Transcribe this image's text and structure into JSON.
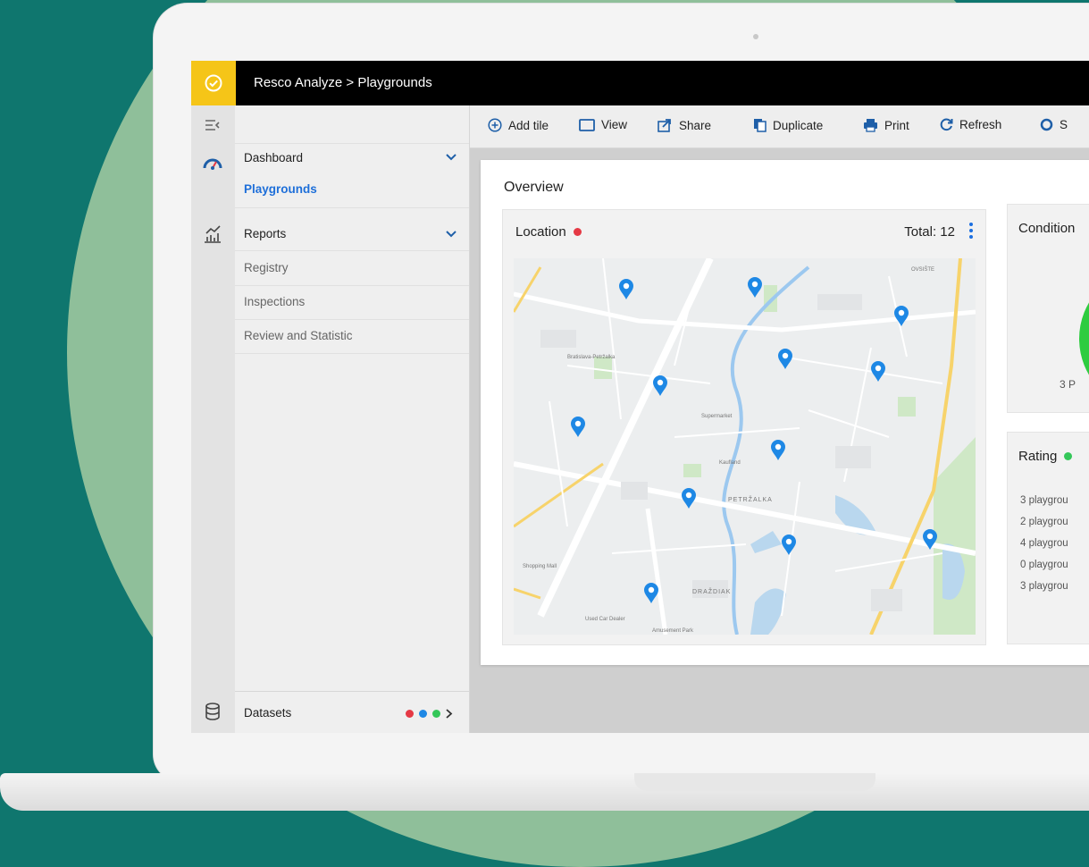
{
  "app": {
    "breadcrumb": "Resco Analyze  >  Playgrounds",
    "brand_color": "#f5c518"
  },
  "sidebar": {
    "sections": [
      {
        "label": "Dashboard",
        "items": [
          "Playgrounds"
        ],
        "active_item": "Playgrounds"
      },
      {
        "label": "Reports",
        "items": [
          "Registry",
          "Inspections",
          "Review and Statistic"
        ]
      }
    ],
    "datasets_label": "Datasets",
    "datasets_dot_colors": [
      "#e53945",
      "#1e88e5",
      "#34c759"
    ]
  },
  "toolbar": {
    "buttons": [
      {
        "label": "Add tile",
        "icon": "plus-circle-icon"
      },
      {
        "label": "View",
        "icon": "window-icon"
      },
      {
        "label": "Share",
        "icon": "share-icon"
      },
      {
        "label": "Duplicate",
        "icon": "duplicate-icon"
      },
      {
        "label": "Print",
        "icon": "printer-icon"
      },
      {
        "label": "Refresh",
        "icon": "refresh-icon"
      },
      {
        "label": "S",
        "icon": "settings-icon"
      }
    ]
  },
  "overview": {
    "title": "Overview",
    "location": {
      "title": "Location",
      "status_color": "#e53945",
      "total": "Total: 12"
    },
    "condition": {
      "title": "Condition",
      "caption": "3 P"
    },
    "rating": {
      "title": "Rating",
      "status_color": "#34c759",
      "rows": [
        "3 playgrou",
        "2 playgrou",
        "4 playgrou",
        "0 playgrou",
        "3 playgrou"
      ]
    }
  },
  "map": {
    "labels": [
      "OVSIŠTE",
      "PETRŽALKA",
      "DRAŽDIAK",
      "Bratislava-Petržalka",
      "Supermarket",
      "Kaufland",
      "Shopping Mall",
      "Used Car Dealer",
      "Amusement Park"
    ],
    "pin_color": "#1e88e5"
  }
}
